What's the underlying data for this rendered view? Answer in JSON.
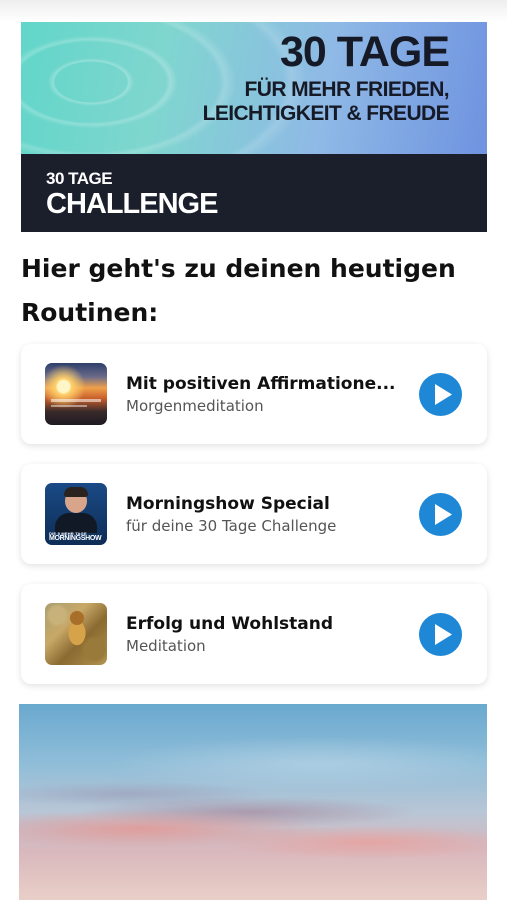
{
  "hero": {
    "title_line1": "30 TAGE",
    "title_line2": "FÜR MEHR FRIEDEN,",
    "title_line3": "LEICHTIGKEIT & FREUDE",
    "band_small": "30 TAGE",
    "band_big": "CHALLENGE"
  },
  "heading": "Hier geht's zu deinen heutigen Routinen:",
  "routines": [
    {
      "title": "Mit positiven Affirmatione...",
      "subtitle": "Morgenmeditation",
      "icon": "sunrise-thumbnail"
    },
    {
      "title": "Morningshow Special",
      "subtitle": "für deine 30 Tage Challenge",
      "icon": "morningshow-thumbnail",
      "thumb_text_small": "DIE 5 MEHR TAGE",
      "thumb_text_big": "MORNINGSHOW"
    },
    {
      "title": "Erfolg und Wohlstand",
      "subtitle": "Meditation",
      "icon": "statue-thumbnail"
    }
  ],
  "colors": {
    "accent": "#1e88d6",
    "band": "#1b1f2c"
  }
}
